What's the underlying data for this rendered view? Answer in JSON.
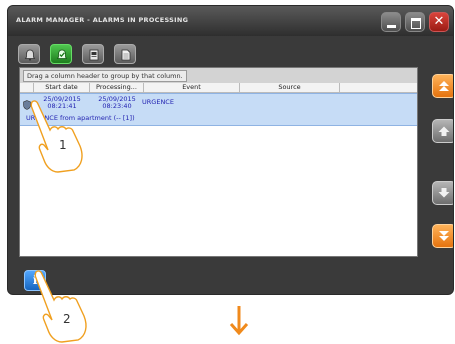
{
  "window": {
    "title": "ALARM MANAGER - ALARMS IN PROCESSING",
    "controls": {
      "minimize": "minimize",
      "maximize": "maximize",
      "close": "✕"
    }
  },
  "toolbar": {
    "buttons": [
      {
        "icon": "bell-icon",
        "active": false
      },
      {
        "icon": "bell-check-icon",
        "active": true
      },
      {
        "icon": "document-icon",
        "active": false
      },
      {
        "icon": "page-icon",
        "active": false
      }
    ]
  },
  "grid": {
    "group_hint": "Drag a column header to group by that column.",
    "columns": [
      "Start date",
      "Processing...",
      "Event",
      "Source"
    ],
    "rows": [
      {
        "start_date": "25/09/2015",
        "start_time": "08:21:41",
        "processing_date": "25/09/2015",
        "processing_time": "08:23:40",
        "event": "URGENCE",
        "source": "",
        "description": "URGENCE from apartment (-- [1])"
      }
    ]
  },
  "sidebar": {
    "buttons": [
      "scroll-top-icon",
      "scroll-up-icon",
      "scroll-down-icon",
      "scroll-bottom-icon"
    ]
  },
  "bottom": {
    "info_label": "i"
  },
  "callouts": {
    "first": "1",
    "second": "2"
  },
  "colors": {
    "selected_row": "#c6dcf6",
    "row_text": "#1f1fb0",
    "accent_orange": "#f28c1c",
    "close_red": "#c2302a",
    "active_green": "#2ea02e"
  }
}
